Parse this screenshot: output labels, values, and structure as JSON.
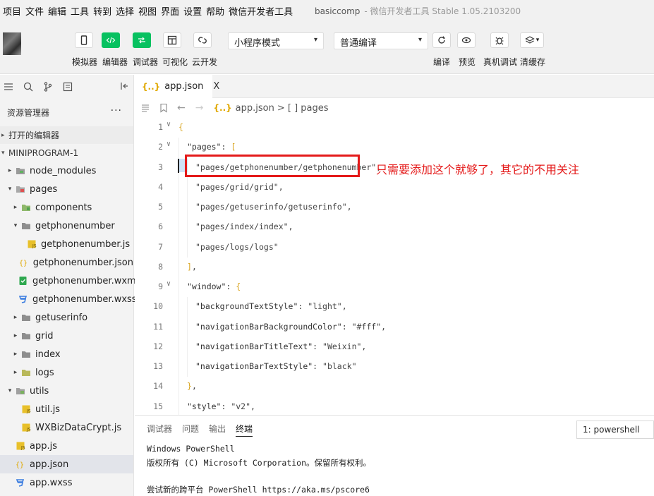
{
  "menubar": {
    "items": [
      "项目",
      "文件",
      "编辑",
      "工具",
      "转到",
      "选择",
      "视图",
      "界面",
      "设置",
      "帮助",
      "微信开发者工具"
    ],
    "project": "basiccomp",
    "window_title": "- 微信开发者工具 Stable 1.05.2103200"
  },
  "toolbar": {
    "simulator": "模拟器",
    "editor": "编辑器",
    "debugger": "调试器",
    "visual": "可视化",
    "cloud": "云开发",
    "mode_select": "小程序模式",
    "compile_select": "普通编译",
    "compile": "编译",
    "preview": "预览",
    "remote_debug": "真机调试",
    "clear_cache": "清缓存"
  },
  "sidebar": {
    "title": "资源管理器",
    "more": "···",
    "open_editors": "打开的编辑器",
    "project_root": "MINIPROGRAM-1",
    "tree": [
      {
        "label": "node_modules",
        "type": "folder-npm",
        "indent": 1,
        "twisty": "▸"
      },
      {
        "label": "pages",
        "type": "folder-red",
        "indent": 1,
        "twisty": "▾"
      },
      {
        "label": "components",
        "type": "folder-green",
        "indent": 2,
        "twisty": "▸"
      },
      {
        "label": "getphonenumber",
        "type": "folder-gray",
        "indent": 2,
        "twisty": "▾"
      },
      {
        "label": "getphonenumber.js",
        "type": "js",
        "indent": 3,
        "twisty": ""
      },
      {
        "label": "getphonenumber.json",
        "type": "json",
        "indent": 3,
        "twisty": ""
      },
      {
        "label": "getphonenumber.wxml",
        "type": "wxml",
        "indent": 3,
        "twisty": ""
      },
      {
        "label": "getphonenumber.wxss",
        "type": "wxss",
        "indent": 3,
        "twisty": ""
      },
      {
        "label": "getuserinfo",
        "type": "folder-gray",
        "indent": 2,
        "twisty": "▸"
      },
      {
        "label": "grid",
        "type": "folder-gray",
        "indent": 2,
        "twisty": "▸"
      },
      {
        "label": "index",
        "type": "folder-gray",
        "indent": 2,
        "twisty": "▸"
      },
      {
        "label": "logs",
        "type": "folder-lime",
        "indent": 2,
        "twisty": "▸"
      },
      {
        "label": "utils",
        "type": "folder-utils",
        "indent": 1,
        "twisty": "▾"
      },
      {
        "label": "util.js",
        "type": "js",
        "indent": 2,
        "twisty": ""
      },
      {
        "label": "WXBizDataCrypt.js",
        "type": "js",
        "indent": 2,
        "twisty": ""
      },
      {
        "label": "app.js",
        "type": "js",
        "indent": 1,
        "twisty": ""
      },
      {
        "label": "app.json",
        "type": "json",
        "indent": 1,
        "twisty": "",
        "selected": true
      },
      {
        "label": "app.wxss",
        "type": "wxss",
        "indent": 1,
        "twisty": ""
      }
    ]
  },
  "editor": {
    "tab_label": "app.json",
    "tab_close": "X",
    "breadcrumb_file": "app.json",
    "breadcrumb_rest": "> [ ] pages",
    "lines": [
      {
        "n": "1",
        "fold": "v",
        "indent": 0,
        "parts": [
          {
            "t": "{",
            "c": "tok-br"
          }
        ]
      },
      {
        "n": "2",
        "fold": "v",
        "indent": 1,
        "parts": [
          {
            "t": "\"pages\"",
            "c": "tok-key"
          },
          {
            "t": ": ",
            "c": "tok-pun"
          },
          {
            "t": "[",
            "c": "tok-br"
          }
        ]
      },
      {
        "n": "3",
        "fold": "",
        "indent": 2,
        "parts": [
          {
            "t": "\"pages/getphonenumber/getphonenumber\"",
            "c": "tok-str"
          },
          {
            "t": ",",
            "c": "tok-pun"
          }
        ]
      },
      {
        "n": "4",
        "fold": "",
        "indent": 2,
        "parts": [
          {
            "t": "\"pages/grid/grid\"",
            "c": "tok-str"
          },
          {
            "t": ",",
            "c": "tok-pun"
          }
        ]
      },
      {
        "n": "5",
        "fold": "",
        "indent": 2,
        "parts": [
          {
            "t": "\"pages/getuserinfo/getuserinfo\"",
            "c": "tok-str"
          },
          {
            "t": ",",
            "c": "tok-pun"
          }
        ]
      },
      {
        "n": "6",
        "fold": "",
        "indent": 2,
        "parts": [
          {
            "t": "\"pages/index/index\"",
            "c": "tok-str"
          },
          {
            "t": ",",
            "c": "tok-pun"
          }
        ]
      },
      {
        "n": "7",
        "fold": "",
        "indent": 2,
        "parts": [
          {
            "t": "\"pages/logs/logs\"",
            "c": "tok-str"
          }
        ]
      },
      {
        "n": "8",
        "fold": "",
        "indent": 1,
        "parts": [
          {
            "t": "]",
            "c": "tok-br"
          },
          {
            "t": ",",
            "c": "tok-pun"
          }
        ]
      },
      {
        "n": "9",
        "fold": "v",
        "indent": 1,
        "parts": [
          {
            "t": "\"window\"",
            "c": "tok-key"
          },
          {
            "t": ": ",
            "c": "tok-pun"
          },
          {
            "t": "{",
            "c": "tok-br"
          }
        ]
      },
      {
        "n": "10",
        "fold": "",
        "indent": 2,
        "parts": [
          {
            "t": "\"backgroundTextStyle\"",
            "c": "tok-key"
          },
          {
            "t": ": ",
            "c": "tok-pun"
          },
          {
            "t": "\"light\"",
            "c": "tok-str"
          },
          {
            "t": ",",
            "c": "tok-pun"
          }
        ]
      },
      {
        "n": "11",
        "fold": "",
        "indent": 2,
        "parts": [
          {
            "t": "\"navigationBarBackgroundColor\"",
            "c": "tok-key"
          },
          {
            "t": ": ",
            "c": "tok-pun"
          },
          {
            "t": "\"#fff\"",
            "c": "tok-str"
          },
          {
            "t": ",",
            "c": "tok-pun"
          }
        ]
      },
      {
        "n": "12",
        "fold": "",
        "indent": 2,
        "parts": [
          {
            "t": "\"navigationBarTitleText\"",
            "c": "tok-key"
          },
          {
            "t": ": ",
            "c": "tok-pun"
          },
          {
            "t": "\"Weixin\"",
            "c": "tok-str"
          },
          {
            "t": ",",
            "c": "tok-pun"
          }
        ]
      },
      {
        "n": "13",
        "fold": "",
        "indent": 2,
        "parts": [
          {
            "t": "\"navigationBarTextStyle\"",
            "c": "tok-key"
          },
          {
            "t": ": ",
            "c": "tok-pun"
          },
          {
            "t": "\"black\"",
            "c": "tok-str"
          }
        ]
      },
      {
        "n": "14",
        "fold": "",
        "indent": 1,
        "parts": [
          {
            "t": "}",
            "c": "tok-br"
          },
          {
            "t": ",",
            "c": "tok-pun"
          }
        ]
      },
      {
        "n": "15",
        "fold": "",
        "indent": 1,
        "parts": [
          {
            "t": "\"style\"",
            "c": "tok-key"
          },
          {
            "t": ": ",
            "c": "tok-pun"
          },
          {
            "t": "\"v2\"",
            "c": "tok-str"
          },
          {
            "t": ",",
            "c": "tok-pun"
          }
        ]
      }
    ],
    "annotation": "只需要添加这个就够了，其它的不用关注"
  },
  "panel": {
    "tabs": [
      "调试器",
      "问题",
      "输出",
      "终端"
    ],
    "active_tab": 3,
    "terminal_select": "1: powershell",
    "terminal_lines": [
      "Windows PowerShell",
      "版权所有 (C) Microsoft Corporation。保留所有权利。",
      "",
      "尝试新的跨平台 PowerShell https://aka.ms/pscore6"
    ]
  },
  "colors": {
    "accent_green": "#07c160",
    "annotation_red": "#e41a1a",
    "json_brace": "#d9a520"
  }
}
